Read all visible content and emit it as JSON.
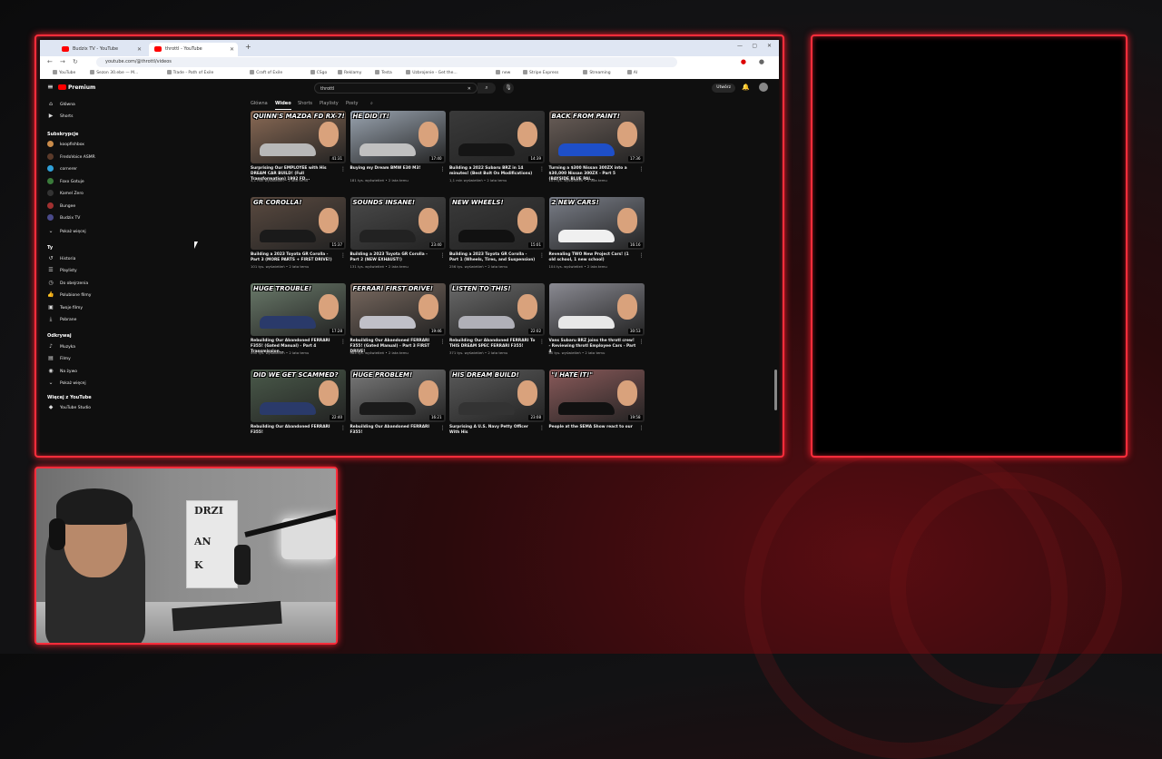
{
  "browser": {
    "tabs": [
      {
        "label": "Budzix TV - YouTube"
      },
      {
        "label": "throttl - YouTube"
      }
    ],
    "new_tab": "+",
    "url": "youtube.com/@throttl/videos",
    "bookmarks": [
      "YouTube",
      "Sezon 30.ebe — M...",
      "Trade - Path of Exile",
      "Craft of Exile",
      "CSgo",
      "Reklamy",
      "Testa",
      "Uzbrojenie - Get the...",
      "new",
      "Stripe Express",
      "Streaming",
      "AI"
    ]
  },
  "youtube": {
    "logo": "Premium",
    "search_query": "throttl",
    "create_label": "Utwórz",
    "sidebar": {
      "main": [
        {
          "label": "Główna",
          "icon": "home-icon"
        },
        {
          "label": "Shorts",
          "icon": "shorts-icon"
        }
      ],
      "subs_header": "Subskrypcje",
      "subs": [
        {
          "label": "koopfishbox",
          "color": "#c98b4a"
        },
        {
          "label": "FredoVoice ASMR",
          "color": "#5a3a2a"
        },
        {
          "label": "cornerer",
          "color": "#2fa0d8"
        },
        {
          "label": "Foxx Gotuje",
          "color": "#3a7a3a"
        },
        {
          "label": "Kamel Zero",
          "color": "#333"
        },
        {
          "label": "Bungee",
          "color": "#a03030"
        },
        {
          "label": "Budzix TV",
          "color": "#4a4a8a"
        }
      ],
      "show_more": "Pokaż więcej",
      "you_header": "Ty",
      "you": [
        {
          "label": "Historia",
          "icon": "history-icon"
        },
        {
          "label": "Playlisty",
          "icon": "playlist-icon"
        },
        {
          "label": "Do obejrzenia",
          "icon": "watch-later-icon"
        },
        {
          "label": "Polubione filmy",
          "icon": "like-icon"
        },
        {
          "label": "Twoje filmy",
          "icon": "my-videos-icon"
        },
        {
          "label": "Pobrane",
          "icon": "download-icon"
        }
      ],
      "explore_header": "Odkrywaj",
      "explore": [
        {
          "label": "Muzyka",
          "icon": "music-icon"
        },
        {
          "label": "Filmy",
          "icon": "film-icon"
        },
        {
          "label": "Na żywo",
          "icon": "live-icon"
        },
        {
          "label": "Pokaż więcej",
          "icon": "chevron-down-icon"
        }
      ],
      "more_header": "Więcej z YouTube",
      "more": [
        {
          "label": "YouTube Studio",
          "icon": "studio-icon"
        }
      ]
    },
    "channel_tabs": [
      "Główna",
      "Wideo",
      "Shorts",
      "Playlisty",
      "Posty"
    ],
    "videos": [
      {
        "caption": "QUINN'S MAZDA FD RX-7!",
        "duration": "41:31",
        "title": "Surprising Our EMPLOYEE with His DREAM CAR BUILD! (Full Transformation) 1992 FD...",
        "meta": "4,1 mln wyświetleń • 2 lata temu",
        "bg": "#8a6a55",
        "car": "#b8b8b8"
      },
      {
        "caption": "HE DID IT!",
        "duration": "17:40",
        "title": "Buying my Dream BMW E30 M3!",
        "meta": "181 tys. wyświetleń • 2 lata temu",
        "bg": "#9aa4b0",
        "car": "#c0c0c0"
      },
      {
        "caption": "",
        "duration": "14:39",
        "title": "Building a 2022 Subaru BRZ in 14 minutes! (Best Bolt On Modifications)",
        "meta": "1,1 mln wyświetleń • 2 lata temu",
        "bg": "#3a3a3a",
        "car": "#151515"
      },
      {
        "caption": "BACK FROM PAINT!",
        "duration": "17:36",
        "title": "Turning a $300 Nissan 300ZX into a $30,000 Nissan 300ZX - Part 5 (BAYSIDE BLUE PAI...",
        "meta": "103 tys. wyświetleń • 2 lata temu",
        "bg": "#6a5e58",
        "car": "#1e4fc8"
      },
      {
        "caption": "GR COROLLA!",
        "duration": "15:37",
        "title": "Building a 2023 Toyota GR Corolla - Part 3 (MORE PARTS + FIRST DRIVE!)",
        "meta": "101 tys. wyświetleń • 2 lata temu",
        "bg": "#5a4a40",
        "car": "#1a1a1a"
      },
      {
        "caption": "SOUNDS INSANE!",
        "duration": "23:40",
        "title": "Building a 2023 Toyota GR Corolla - Part 2 (NEW EXHAUST!)",
        "meta": "131 tys. wyświetleń • 2 lata temu",
        "bg": "#4a4a4a",
        "car": "#222"
      },
      {
        "caption": "NEW WHEELS!",
        "duration": "15:01",
        "title": "Building a 2023 Toyota GR Corolla - Part 1 (Wheels, Tires, and Suspension)",
        "meta": "256 tys. wyświetleń • 2 lata temu",
        "bg": "#3a3a3a",
        "car": "#111"
      },
      {
        "caption": "2 NEW CARS!",
        "duration": "16:16",
        "title": "Revealing TWO New Project Cars! (1 old school, 1 new school)",
        "meta": "104 tys. wyświetleń • 2 lata temu",
        "bg": "#7a7e88",
        "car": "#f0f0f0"
      },
      {
        "caption": "HUGE TROUBLE!",
        "duration": "17:28",
        "title": "Rebuilding Our Abandoned FERRARI F355! (Gated Manual) - Part 4 Transmission...",
        "meta": "590 tys. wyświetleń • 2 lata temu",
        "bg": "#6a7a6a",
        "car": "#2a3a6a"
      },
      {
        "caption": "FERRARI FIRST DRIVE!",
        "duration": "19:46",
        "title": "Rebuilding Our Abandoned FERRARI F355! (Gated Manual) - Part 3 FIRST DRIVE!",
        "meta": "984 tys. wyświetleń • 2 lata temu",
        "bg": "#7a6a60",
        "car": "#c0c0c8"
      },
      {
        "caption": "LISTEN TO THIS!",
        "duration": "22:02",
        "title": "Rebuilding Our Abandoned FERRARI To THIS DREAM SPEC FERRARI F355!",
        "meta": "371 tys. wyświetleń • 2 lata temu",
        "bg": "#6a6a6a",
        "car": "#b0b0b8"
      },
      {
        "caption": "",
        "duration": "30:53",
        "title": "Vans Subaru BRZ joins the throtl crew! - Reviewing throtl Employee Cars - Part 4",
        "meta": "80 tys. wyświetleń • 2 lata temu",
        "bg": "#8a8a92",
        "car": "#e8e8e8"
      },
      {
        "caption": "DID WE GET SCAMMED?",
        "duration": "22:40",
        "title": "Rebuilding Our Abandoned FERRARI F355!",
        "meta": "",
        "bg": "#4a5a4a",
        "car": "#2a3a6a"
      },
      {
        "caption": "HUGE PROBLEM!",
        "duration": "16:21",
        "title": "Rebuilding Our Abandoned FERRARI F355!",
        "meta": "",
        "bg": "#7a7a7a",
        "car": "#1a1a1a"
      },
      {
        "caption": "HIS DREAM BUILD!",
        "duration": "23:08",
        "title": "Surprising A U.S. Navy Petty Officer With His",
        "meta": "",
        "bg": "#5a5a5a",
        "car": "#333"
      },
      {
        "caption": "\"I HATE IT!\"",
        "duration": "19:58",
        "title": "People at the SEMA Show react to our",
        "meta": "",
        "bg": "#8a5a5a",
        "car": "#111"
      }
    ]
  },
  "webcam": {
    "poster_text": [
      "DRZI",
      "AN",
      "K"
    ]
  },
  "colors": {
    "accent": "#ff2d3b",
    "yt_red": "#ff0000"
  }
}
